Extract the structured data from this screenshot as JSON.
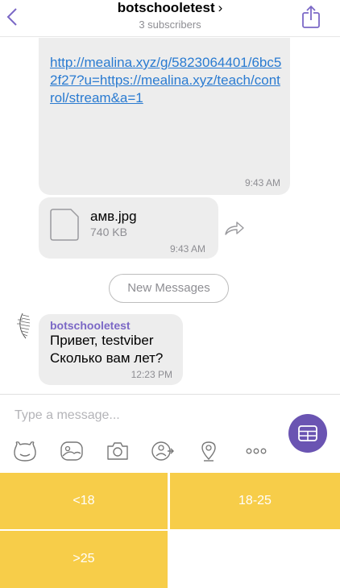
{
  "header": {
    "title": "botschooletest",
    "title_arrow": "›",
    "subtitle": "3 subscribers"
  },
  "messages": {
    "link": {
      "url": "http://mealina.xyz/g/5823064401/6bc52f27?u=https://mealina.xyz/teach/control/stream&a=1",
      "time": "9:43 AM"
    },
    "file": {
      "name": "амв.jpg",
      "size": "740 KB",
      "time": "9:43 AM"
    },
    "divider": "New Messages",
    "bot_message": {
      "sender": "botschooletest",
      "line1": "Привет, testviber",
      "line2": "Сколько вам лет?",
      "time": "12:23 PM"
    }
  },
  "composer": {
    "placeholder": "Type a message...",
    "tools": [
      "sticker-icon",
      "gallery-icon",
      "camera-icon",
      "video-message-icon",
      "location-icon",
      "more-icon"
    ]
  },
  "keyboard": {
    "buttons": [
      "<18",
      "18-25",
      ">25"
    ]
  },
  "colors": {
    "accent": "#7b68c6",
    "keyboard_button": "#f7cd49",
    "bubble": "#ededed",
    "link": "#2a7bd1"
  }
}
